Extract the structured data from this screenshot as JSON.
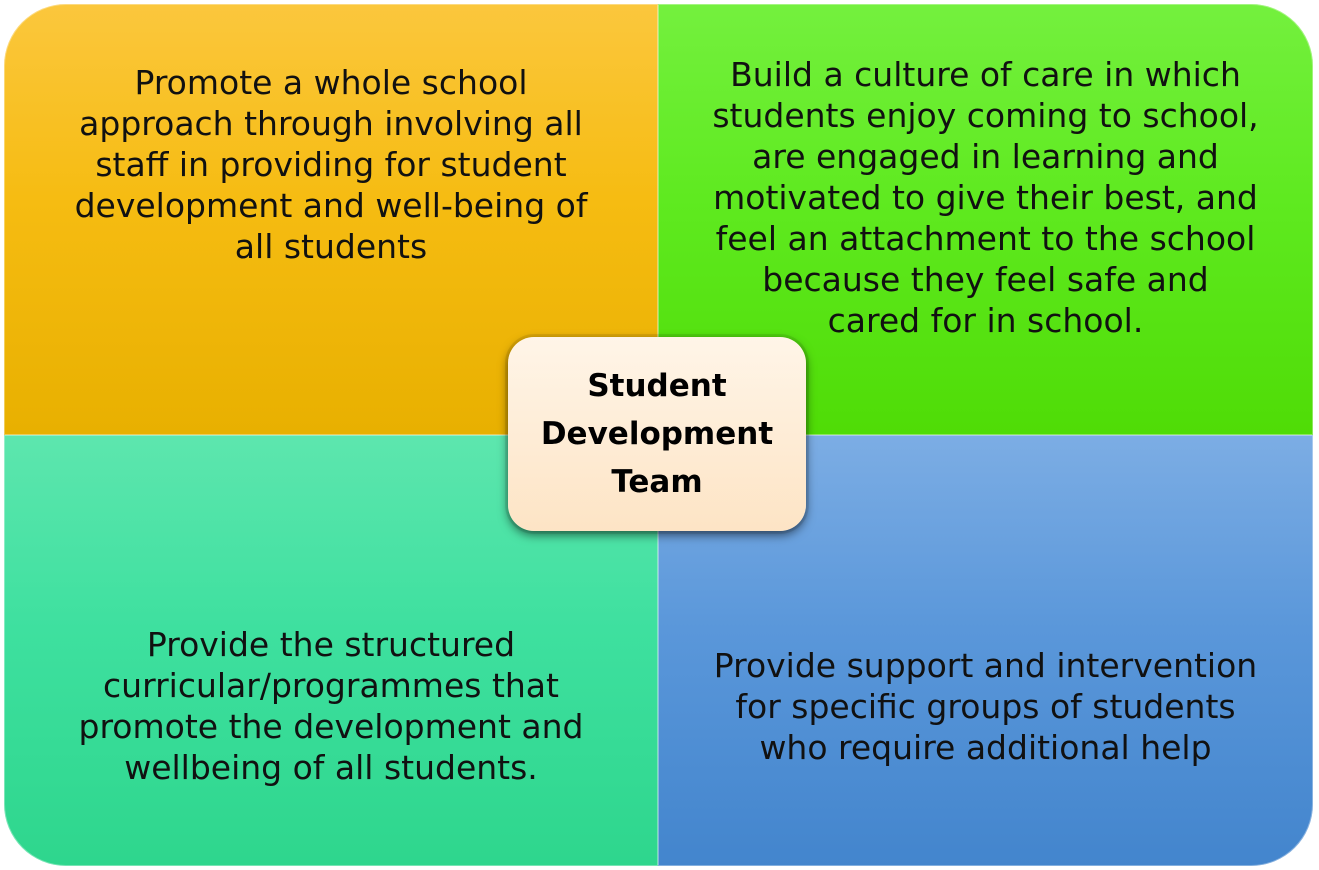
{
  "center": {
    "line1": "Student",
    "line2": "Development",
    "line3": "Team"
  },
  "quadrants": {
    "top_left": {
      "lines": [
        "Promote a whole school",
        "approach through involving all",
        "staff in providing for student",
        "development and well-being of",
        "all students"
      ]
    },
    "top_right": {
      "lines": [
        "Build a culture of care in which",
        "students enjoy coming to school,",
        "are engaged in learning and",
        "motivated to give their best, and",
        "feel an attachment to the school",
        "because they feel safe and",
        "cared for in school."
      ]
    },
    "bottom_left": {
      "lines": [
        "Provide the structured",
        "curricular/programmes that",
        "promote the development and",
        "wellbeing of all students."
      ]
    },
    "bottom_right": {
      "lines": [
        "Provide support and intervention",
        "for specific groups of students",
        "who require additional help"
      ]
    }
  },
  "colors": {
    "top_left": "#f6bc12",
    "top_right": "#5fea20",
    "bottom_left": "#3ee09f",
    "bottom_right": "#5a97da",
    "center": "#fde4c5"
  }
}
